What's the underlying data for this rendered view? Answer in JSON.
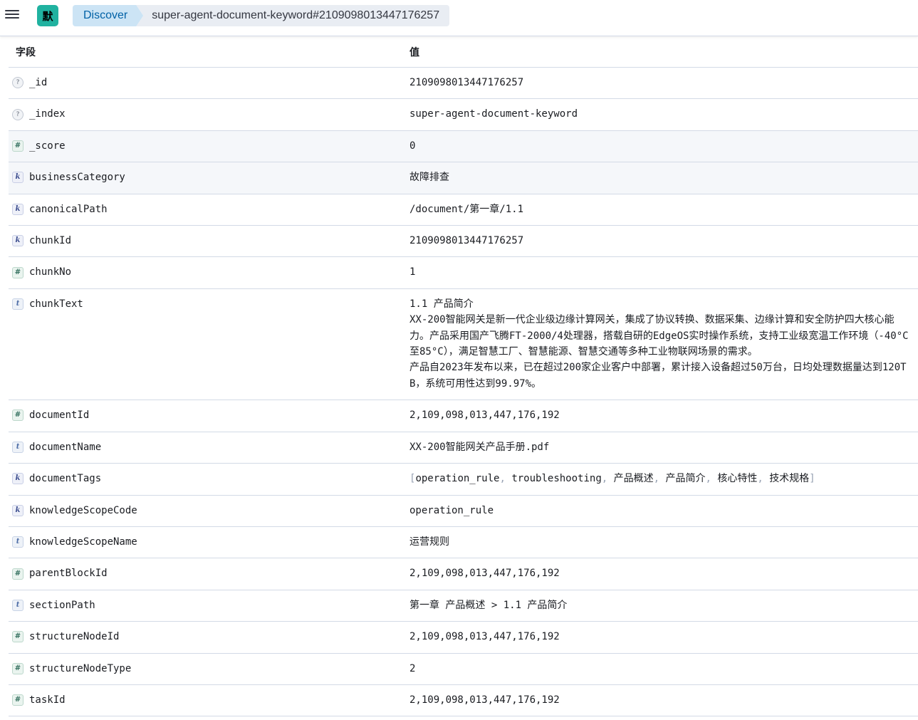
{
  "header": {
    "space_initial": "默",
    "breadcrumbs": [
      {
        "label": "Discover"
      },
      {
        "label": "super-agent-document-keyword#2109098013447176257"
      }
    ]
  },
  "table": {
    "columns": {
      "field": "字段",
      "value": "值"
    },
    "rows": [
      {
        "type": "unknown",
        "type_symbol": "?",
        "field": "_id",
        "value": "2109098013447176257"
      },
      {
        "type": "unknown",
        "type_symbol": "?",
        "field": "_index",
        "value": "super-agent-document-keyword"
      },
      {
        "type": "number",
        "type_symbol": "#",
        "field": "_score",
        "value": "0"
      },
      {
        "type": "keyword",
        "type_symbol": "k",
        "field": "businessCategory",
        "value": "故障排查"
      },
      {
        "type": "keyword",
        "type_symbol": "k",
        "field": "canonicalPath",
        "value": "/document/第一章/1.1"
      },
      {
        "type": "keyword",
        "type_symbol": "k",
        "field": "chunkId",
        "value": "2109098013447176257"
      },
      {
        "type": "number",
        "type_symbol": "#",
        "field": "chunkNo",
        "value": "1"
      },
      {
        "type": "text",
        "type_symbol": "t",
        "field": "chunkText",
        "value": "1.1 产品简介\nXX-200智能网关是新一代企业级边缘计算网关，集成了协议转换、数据采集、边缘计算和安全防护四大核心能力。产品采用国产飞腾FT-2000/4处理器，搭载自研的EdgeOS实时操作系统，支持工业级宽温工作环境（-40°C至85°C），满足智慧工厂、智慧能源、智慧交通等多种工业物联网场景的需求。\n产品自2023年发布以来，已在超过200家企业客户中部署，累计接入设备超过50万台，日均处理数据量达到120TB，系统可用性达到99.97%。"
      },
      {
        "type": "number",
        "type_symbol": "#",
        "field": "documentId",
        "value": "2,109,098,013,447,176,192"
      },
      {
        "type": "text",
        "type_symbol": "t",
        "field": "documentName",
        "value": "XX-200智能网关产品手册.pdf"
      },
      {
        "type": "keyword",
        "type_symbol": "k",
        "field": "documentTags",
        "value": "",
        "tags": [
          "operation_rule",
          "troubleshooting",
          "产品概述",
          "产品简介",
          "核心特性",
          "技术规格"
        ]
      },
      {
        "type": "keyword",
        "type_symbol": "k",
        "field": "knowledgeScopeCode",
        "value": "operation_rule"
      },
      {
        "type": "text",
        "type_symbol": "t",
        "field": "knowledgeScopeName",
        "value": "运营规则"
      },
      {
        "type": "number",
        "type_symbol": "#",
        "field": "parentBlockId",
        "value": "2,109,098,013,447,176,192"
      },
      {
        "type": "text",
        "type_symbol": "t",
        "field": "sectionPath",
        "value": "第一章 产品概述 > 1.1 产品简介"
      },
      {
        "type": "number",
        "type_symbol": "#",
        "field": "structureNodeId",
        "value": "2,109,098,013,447,176,192"
      },
      {
        "type": "number",
        "type_symbol": "#",
        "field": "structureNodeType",
        "value": "2"
      },
      {
        "type": "number",
        "type_symbol": "#",
        "field": "taskId",
        "value": "2,109,098,013,447,176,192"
      }
    ]
  }
}
